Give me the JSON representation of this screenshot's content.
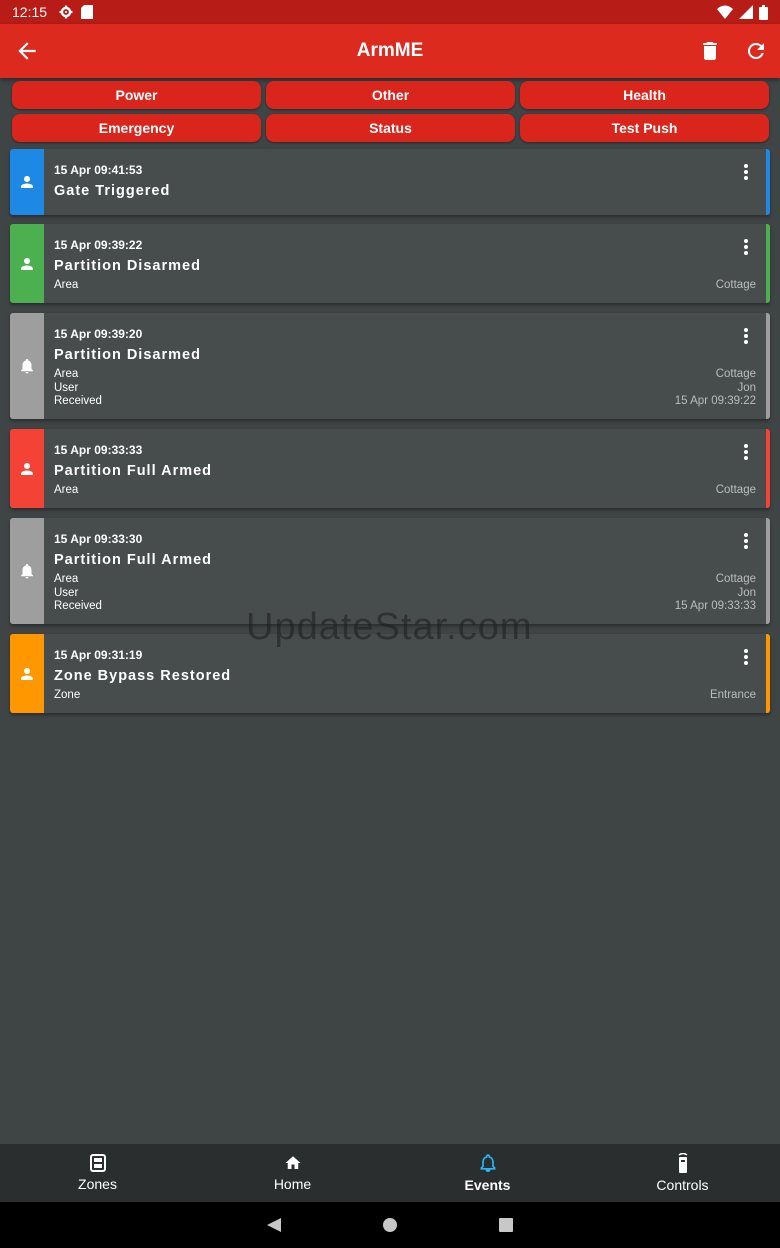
{
  "status_bar": {
    "time": "12:15",
    "icons": [
      "settings-icon",
      "sim-card-icon",
      "wifi-icon",
      "signal-icon",
      "battery-icon"
    ]
  },
  "app_bar": {
    "title": "ArmME",
    "back_icon": "arrow-back-icon",
    "actions": [
      "trash-icon",
      "refresh-icon"
    ]
  },
  "filters": [
    "Power",
    "Other",
    "Health",
    "Emergency",
    "Status",
    "Test Push"
  ],
  "colors": {
    "accent": "#dc2a1f",
    "blue": "#1e88e5",
    "green": "#4caf50",
    "grey": "#9e9e9e",
    "red": "#f44336",
    "orange": "#ff9800",
    "nav_active_icon": "#29b6f6"
  },
  "events": [
    {
      "time": "15 Apr 09:41:53",
      "title": "Gate Triggered",
      "color": "#1e88e5",
      "icon": "person-icon",
      "details": []
    },
    {
      "time": "15 Apr 09:39:22",
      "title": "Partition Disarmed",
      "color": "#4caf50",
      "icon": "person-icon",
      "details": [
        {
          "label": "Area",
          "value": "Cottage"
        }
      ]
    },
    {
      "time": "15 Apr 09:39:20",
      "title": "Partition Disarmed",
      "color": "#9e9e9e",
      "icon": "bell-icon",
      "details": [
        {
          "label": "Area",
          "value": "Cottage"
        },
        {
          "label": "User",
          "value": "Jon"
        },
        {
          "label": "Received",
          "value": "15 Apr 09:39:22"
        }
      ]
    },
    {
      "time": "15 Apr 09:33:33",
      "title": "Partition Full Armed",
      "color": "#f44336",
      "icon": "person-icon",
      "details": [
        {
          "label": "Area",
          "value": "Cottage"
        }
      ]
    },
    {
      "time": "15 Apr 09:33:30",
      "title": "Partition Full Armed",
      "color": "#9e9e9e",
      "icon": "bell-icon",
      "details": [
        {
          "label": "Area",
          "value": "Cottage"
        },
        {
          "label": "User",
          "value": "Jon"
        },
        {
          "label": "Received",
          "value": "15 Apr 09:33:33"
        }
      ]
    },
    {
      "time": "15 Apr 09:31:19",
      "title": "Zone Bypass Restored",
      "color": "#ff9800",
      "icon": "person-icon",
      "details": [
        {
          "label": "Zone",
          "value": "Entrance"
        }
      ]
    }
  ],
  "watermark": "UpdateStar.com",
  "bottom_nav": [
    {
      "label": "Zones",
      "icon": "zones-icon",
      "active": false
    },
    {
      "label": "Home",
      "icon": "home-icon",
      "active": false
    },
    {
      "label": "Events",
      "icon": "bell-icon",
      "active": true
    },
    {
      "label": "Controls",
      "icon": "remote-icon",
      "active": false
    }
  ],
  "system_nav": [
    "back-triangle-icon",
    "home-circle-icon",
    "recents-square-icon"
  ]
}
